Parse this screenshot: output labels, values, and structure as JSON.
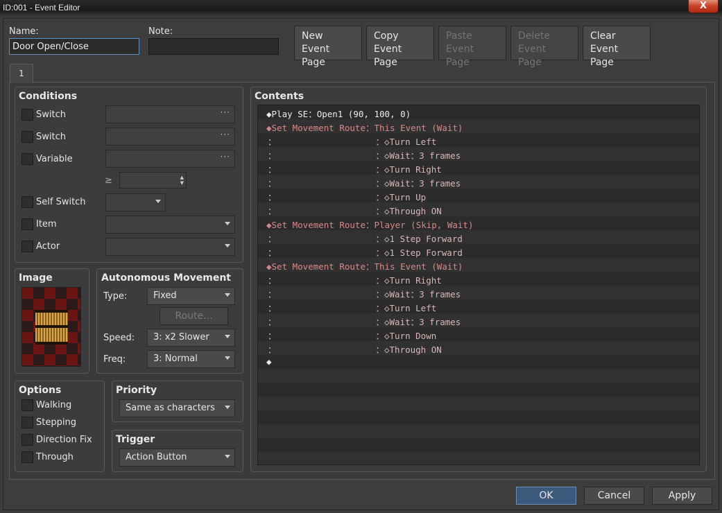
{
  "window": {
    "title": "ID:001 - Event Editor",
    "close_glyph": "X"
  },
  "header": {
    "name_label": "Name:",
    "name_value": "Door Open/Close",
    "note_label": "Note:",
    "note_value": ""
  },
  "toolbar": {
    "new_line1": "New",
    "new_line2": "Event Page",
    "copy_line1": "Copy",
    "copy_line2": "Event Page",
    "paste_line1": "Paste",
    "paste_line2": "Event Page",
    "delete_line1": "Delete",
    "delete_line2": "Event Page",
    "clear_line1": "Clear",
    "clear_line2": "Event Page"
  },
  "tabs": {
    "page1": "1"
  },
  "conditions": {
    "title": "Conditions",
    "switch1": "Switch",
    "switch2": "Switch",
    "variable": "Variable",
    "ge_symbol": "≥",
    "self_switch": "Self Switch",
    "item": "Item",
    "actor": "Actor",
    "ellipsis": "···"
  },
  "image": {
    "title": "Image"
  },
  "autonomous": {
    "title": "Autonomous Movement",
    "type_label": "Type:",
    "type_value": "Fixed",
    "route_button": "Route...",
    "speed_label": "Speed:",
    "speed_value": "3: x2 Slower",
    "freq_label": "Freq:",
    "freq_value": "3: Normal"
  },
  "options": {
    "title": "Options",
    "walking": "Walking",
    "stepping": "Stepping",
    "direction_fix": "Direction Fix",
    "through": "Through"
  },
  "priority": {
    "title": "Priority",
    "value": "Same as characters"
  },
  "trigger": {
    "title": "Trigger",
    "value": "Action Button"
  },
  "contents": {
    "title": "Contents",
    "lines": [
      "◆Play SE：Open1 (90, 100, 0)",
      "◆Set Movement Route：This Event (Wait)",
      "：                   ：◇Turn Left",
      "：                   ：◇Wait：3 frames",
      "：                   ：◇Turn Right",
      "：                   ：◇Wait：3 frames",
      "：                   ：◇Turn Up",
      "：                   ：◇Through ON",
      "◆Set Movement Route：Player (Skip, Wait)",
      "：                   ：◇1 Step Forward",
      "：                   ：◇1 Step Forward",
      "◆Set Movement Route：This Event (Wait)",
      "：                   ：◇Turn Right",
      "：                   ：◇Wait：3 frames",
      "：                   ：◇Turn Left",
      "：                   ：◇Wait：3 frames",
      "：                   ：◇Turn Down",
      "：                   ：◇Through ON",
      "◆"
    ]
  },
  "footer": {
    "ok": "OK",
    "cancel": "Cancel",
    "apply": "Apply"
  },
  "colors": {
    "accent": "#3b5a7c",
    "command_red": "#d58a8a",
    "background": "#3b3b3b"
  }
}
